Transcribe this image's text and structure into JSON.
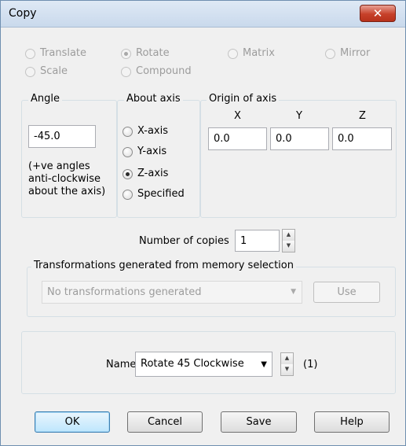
{
  "window": {
    "title": "Copy",
    "close_glyph": "✕"
  },
  "transform_types": {
    "translate": "Translate",
    "rotate": "Rotate",
    "matrix": "Matrix",
    "mirror": "Mirror",
    "scale": "Scale",
    "compound": "Compound",
    "selected": "Rotate"
  },
  "angle": {
    "title": "Angle",
    "value": "-45.0",
    "note_line1": "(+ve angles",
    "note_line2": "anti-clockwise",
    "note_line3": "about the axis)"
  },
  "about_axis": {
    "title": "About axis",
    "options": [
      "X-axis",
      "Y-axis",
      "Z-axis",
      "Specified"
    ],
    "selected": "Z-axis"
  },
  "origin": {
    "title": "Origin of axis",
    "x_label": "X",
    "y_label": "Y",
    "z_label": "Z",
    "x_value": "0.0",
    "y_value": "0.0",
    "z_value": "0.0"
  },
  "copies": {
    "label": "Number of copies",
    "value": "1"
  },
  "memory": {
    "title": "Transformations generated from memory selection",
    "dropdown_value": "No transformations generated",
    "use_label": "Use"
  },
  "name": {
    "label": "Name",
    "value": "Rotate 45 Clockwise",
    "count": "(1)"
  },
  "buttons": {
    "ok": "OK",
    "cancel": "Cancel",
    "save": "Save",
    "help": "Help"
  },
  "colors": {
    "accent": "#3c7fb1",
    "close": "#c6402a"
  }
}
